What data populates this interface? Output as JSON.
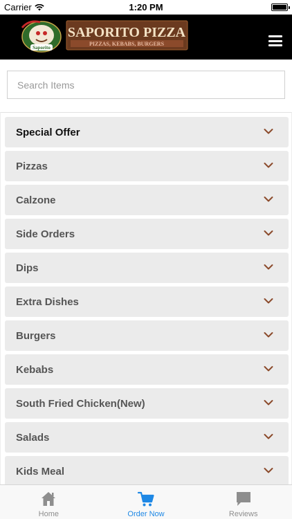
{
  "status_bar": {
    "carrier": "Carrier",
    "time": "1:20 PM"
  },
  "header": {
    "brand_name": "SAPORITO PIZZA",
    "brand_tagline": "PIZZAS, KEBABS, BURGERS",
    "logo_mascot_text": "Saporito",
    "menu_icon": "hamburger-menu-icon"
  },
  "search": {
    "placeholder": "Search Items",
    "value": ""
  },
  "categories": [
    {
      "label": "Special Offer"
    },
    {
      "label": "Pizzas"
    },
    {
      "label": "Calzone"
    },
    {
      "label": "Side Orders"
    },
    {
      "label": "Dips"
    },
    {
      "label": "Extra Dishes"
    },
    {
      "label": "Burgers"
    },
    {
      "label": "Kebabs"
    },
    {
      "label": "South Fried Chicken(New)"
    },
    {
      "label": "Salads"
    },
    {
      "label": "Kids Meal"
    }
  ],
  "tabs": [
    {
      "label": "Home",
      "icon": "home-icon",
      "active": false
    },
    {
      "label": "Order Now",
      "icon": "cart-icon",
      "active": true
    },
    {
      "label": "Reviews",
      "icon": "chat-bubble-icon",
      "active": false
    }
  ],
  "colors": {
    "header_bg": "#000000",
    "chevron": "#8b4a2b",
    "active_tab": "#1e88e5",
    "inactive_tab": "#8e8e8e",
    "category_bg": "#ebebeb",
    "brand_banner": "#6b3a1f"
  }
}
